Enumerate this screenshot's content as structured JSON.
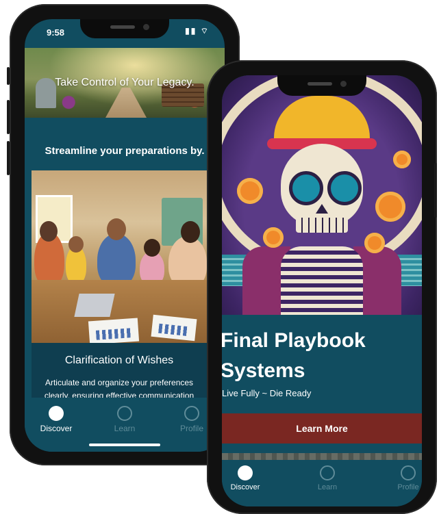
{
  "left_phone": {
    "status_bar": {
      "time": "9:58",
      "signal_icons": "▮▮ ⌔"
    },
    "hero": {
      "title": "Take Control of Your Legacy."
    },
    "section_title": "Streamline your preparations by.",
    "card": {
      "title": "Clarification of Wishes",
      "description": "Articulate and organize your preferences clearly, ensuring effective communication"
    },
    "tabs": [
      {
        "label": "Discover",
        "icon": "compass-icon",
        "active": true
      },
      {
        "label": "Learn",
        "icon": "search-icon",
        "active": false
      },
      {
        "label": "Profile",
        "icon": "user-icon",
        "active": false
      }
    ]
  },
  "right_phone": {
    "promo": {
      "title": "Final Playbook Systems",
      "tagline": "Live Fully ~ Die Ready",
      "button_label": "Learn More"
    },
    "tabs": [
      {
        "label": "Discover",
        "icon": "compass-icon",
        "active": true
      },
      {
        "label": "Learn",
        "icon": "search-icon",
        "active": false
      },
      {
        "label": "Profile",
        "icon": "user-icon",
        "active": false
      }
    ]
  },
  "colors": {
    "background": "#114d60",
    "card": "#0f3e50",
    "button": "#7a2722",
    "tab_active": "#ffffff",
    "tab_inactive": "#5f8c99"
  }
}
